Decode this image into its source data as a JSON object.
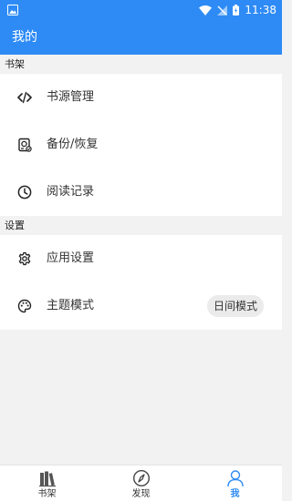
{
  "status_bar": {
    "time": "11:38"
  },
  "app_bar": {
    "title": "我的"
  },
  "sections": {
    "bookshelf": {
      "header": "书架",
      "items": [
        {
          "label": "书源管理",
          "icon": "code-icon"
        },
        {
          "label": "备份/恢复",
          "icon": "backup-icon"
        },
        {
          "label": "阅读记录",
          "icon": "clock-icon"
        }
      ]
    },
    "settings": {
      "header": "设置",
      "items": [
        {
          "label": "应用设置",
          "icon": "gear-icon"
        },
        {
          "label": "主题模式",
          "icon": "palette-icon",
          "value": "日间模式"
        }
      ]
    }
  },
  "bottom_nav": {
    "tabs": [
      {
        "label": "书架",
        "icon": "bookshelf-icon",
        "active": false
      },
      {
        "label": "发现",
        "icon": "compass-icon",
        "active": false
      },
      {
        "label": "我",
        "icon": "person-icon",
        "active": true
      }
    ]
  },
  "colors": {
    "accent": "#2e8bf5",
    "background": "#f2f2f2",
    "panel": "#ffffff"
  }
}
